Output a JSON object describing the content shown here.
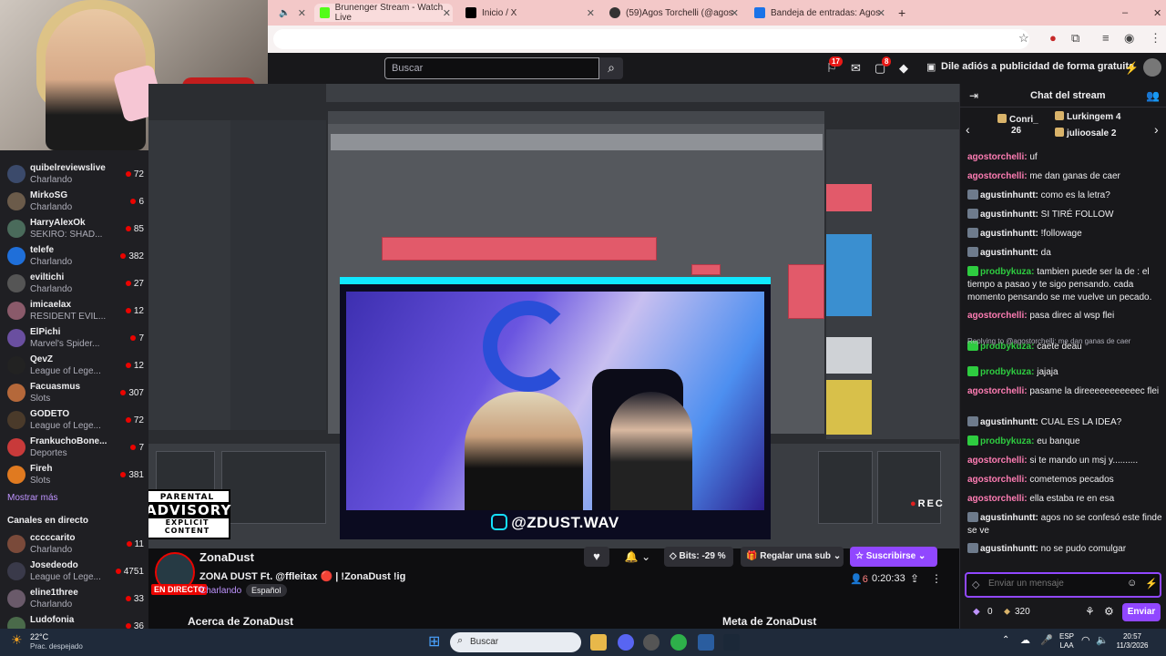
{
  "browser": {
    "tabs": [
      {
        "title": "Brunenger Stream - Watch Live",
        "color": "#53fc18"
      },
      {
        "title": "Inicio / X",
        "color": "#000000"
      },
      {
        "title": "(59)Agos Torchelli (@agostorch",
        "color": "#000000"
      },
      {
        "title": "Bandeja de entradas: Agostina t",
        "color": "#1a73e8"
      }
    ],
    "new_tab": "+"
  },
  "nav": {
    "search_placeholder": "Buscar",
    "notif_badge_1": "17",
    "notif_badge_2": "8",
    "ad_free": "Dile adiós a publicidad de forma gratuita"
  },
  "sidebar": {
    "channels": [
      {
        "name": "quibelreviewslive",
        "game": "Charlando",
        "viewers": "72",
        "color": "#3b4a6b"
      },
      {
        "name": "MirkoSG",
        "game": "Charlando",
        "viewers": "6",
        "color": "#6b5b4a"
      },
      {
        "name": "HarryAlexOk",
        "game": "SEKIRO: SHAD...",
        "viewers": "85",
        "color": "#4a6b5b"
      },
      {
        "name": "telefe",
        "game": "Charlando",
        "viewers": "382",
        "color": "#1f6fd9"
      },
      {
        "name": "eviltichi",
        "game": "Charlando",
        "viewers": "27",
        "color": "#555555"
      },
      {
        "name": "imicaelax",
        "game": "RESIDENT EVIL...",
        "viewers": "12",
        "color": "#8a5a6a"
      },
      {
        "name": "ElPichi",
        "game": "Marvel's Spider...",
        "viewers": "7",
        "color": "#6a4fa0"
      },
      {
        "name": "QevZ",
        "game": "League of Lege...",
        "viewers": "12",
        "color": "#222222"
      },
      {
        "name": "Facuasmus",
        "game": "Slots",
        "viewers": "307",
        "color": "#b5683a"
      },
      {
        "name": "GODETO",
        "game": "League of Lege...",
        "viewers": "72",
        "color": "#4a3a2a"
      },
      {
        "name": "FrankuchoBone...",
        "game": "Deportes",
        "viewers": "7",
        "color": "#c83a3a"
      },
      {
        "name": "Fireh",
        "game": "Slots",
        "viewers": "381",
        "color": "#e07a20"
      }
    ],
    "show_more": "Mostrar más",
    "live_heading": "Canales en directo",
    "live_channels": [
      {
        "name": "cccccarito",
        "game": "Charlando",
        "viewers": "11",
        "color": "#7a4a3a"
      },
      {
        "name": "Josedeodo",
        "game": "League of Lege...",
        "viewers": "4751",
        "color": "#3a3a4a"
      },
      {
        "name": "eline1three",
        "game": "Charlando",
        "viewers": "33",
        "color": "#6a5a6a"
      },
      {
        "name": "Ludofonia",
        "game": "",
        "viewers": "36",
        "color": "#4a6a4a"
      }
    ]
  },
  "video": {
    "advisory_top": "PARENTAL",
    "advisory_mid": "ADVISORY",
    "advisory_bottom": "EXPLICIT CONTENT",
    "cam_handle": "@ZDUST.WAV"
  },
  "stream": {
    "live_label": "EN DIRECTO",
    "channel": "ZonaDust",
    "title": "ZONA DUST Ft. @ffleitax 🔴 | !ZonaDust !ig",
    "category": "Charlando",
    "tag": "Español",
    "bits_label": "Bits: -29 %",
    "gift_label": "Regalar una sub",
    "sub_label": "Suscribirse",
    "viewers": "6",
    "uptime": "0:20:33",
    "about": "Acerca de ZonaDust",
    "meta": "Meta de ZonaDust"
  },
  "chat": {
    "title": "Chat del stream",
    "gifters": [
      {
        "name": "Conri_",
        "count": "26"
      },
      {
        "name": "Lurkingem",
        "count": "4"
      },
      {
        "name": "julioosale",
        "count": "2"
      }
    ],
    "messages": [
      {
        "user": "agostorchelli:",
        "text": " uf",
        "color": "#ff7db4",
        "badge": ""
      },
      {
        "user": "agostorchelli:",
        "text": " me dan ganas de caer",
        "color": "#ff7db4",
        "badge": ""
      },
      {
        "user": "agustinhuntt:",
        "text": " como es la letra?",
        "color": "#efeff1",
        "badge": "#6e7b8c"
      },
      {
        "user": "agustinhuntt:",
        "text": " SI TIRÉ FOLLOW",
        "color": "#efeff1",
        "badge": "#6e7b8c"
      },
      {
        "user": "agustinhuntt:",
        "text": " !followage",
        "color": "#efeff1",
        "badge": "#6e7b8c"
      },
      {
        "user": "agustinhuntt:",
        "text": " da",
        "color": "#efeff1",
        "badge": "#6e7b8c"
      },
      {
        "user": "prodbykuza:",
        "text": " tambien puede ser la de : el tiempo a pasao y te sigo pensando. cada momento pensando se me vuelve un pecado.",
        "color": "#2ecc40",
        "badge": "#2ecc40"
      },
      {
        "user": "agostorchelli:",
        "text": " pasa direc al wsp flei",
        "color": "#ff7db4",
        "badge": ""
      },
      {
        "user": "prodbykuza:",
        "text": " caete deau",
        "color": "#2ecc40",
        "badge": "#2ecc40"
      },
      {
        "user": "prodbykuza:",
        "text": " jajaja",
        "color": "#2ecc40",
        "badge": "#2ecc40"
      },
      {
        "user": "agostorchelli:",
        "text": " pasame la direeeeeeeeeeec flei",
        "color": "#ff7db4",
        "badge": ""
      },
      {
        "user": "agustinhuntt:",
        "text": " CUAL ES LA IDEA?",
        "color": "#efeff1",
        "badge": "#6e7b8c"
      },
      {
        "user": "prodbykuza:",
        "text": " eu banque",
        "color": "#2ecc40",
        "badge": "#2ecc40"
      },
      {
        "user": "agostorchelli:",
        "text": " si te mando un msj y..........",
        "color": "#ff7db4",
        "badge": ""
      },
      {
        "user": "agostorchelli:",
        "text": " cometemos pecados",
        "color": "#ff7db4",
        "badge": ""
      },
      {
        "user": "agostorchelli:",
        "text": " ella estaba re en esa",
        "color": "#ff7db4",
        "badge": ""
      },
      {
        "user": "agustinhuntt:",
        "text": " agos no se confesó este finde se ve",
        "color": "#efeff1",
        "badge": "#6e7b8c"
      },
      {
        "user": "agustinhuntt:",
        "text": " no se pudo comulgar",
        "color": "#efeff1",
        "badge": "#6e7b8c"
      }
    ],
    "reply_note": "Replying to @agostorchelli: me dan ganas de caer",
    "input_placeholder": "Enviar un mensaje",
    "bits_count": "0",
    "points_count": "320",
    "send_label": "Enviar"
  },
  "taskbar": {
    "temp": "22°C",
    "weather": "Prac. despejado",
    "search_label": "Buscar",
    "lang_top": "ESP",
    "lang_bottom": "LAA",
    "time": "20:57",
    "date": "11/3/2026"
  }
}
